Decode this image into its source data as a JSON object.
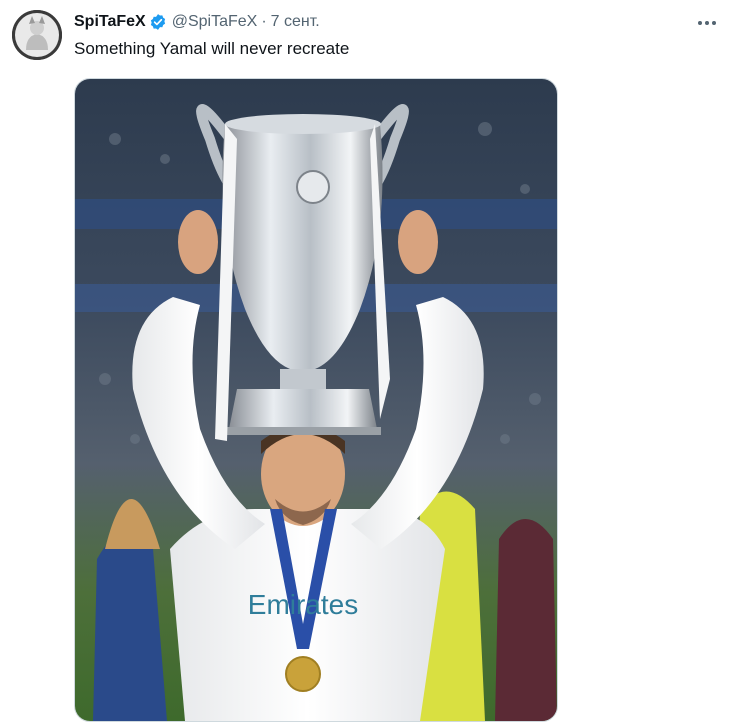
{
  "tweet": {
    "display_name": "SpiTaFeX",
    "handle": "@SpiTaFeX",
    "separator": "·",
    "timestamp": "7 сент.",
    "text": "Something Yamal will never recreate",
    "verified_icon": "verified-badge-icon",
    "more_icon": "more-horizontal-icon"
  },
  "media": {
    "shirt_sponsor": "Emirates"
  },
  "colors": {
    "verified": "#1d9bf0",
    "text_primary": "#0f1419",
    "text_secondary": "#536471"
  }
}
